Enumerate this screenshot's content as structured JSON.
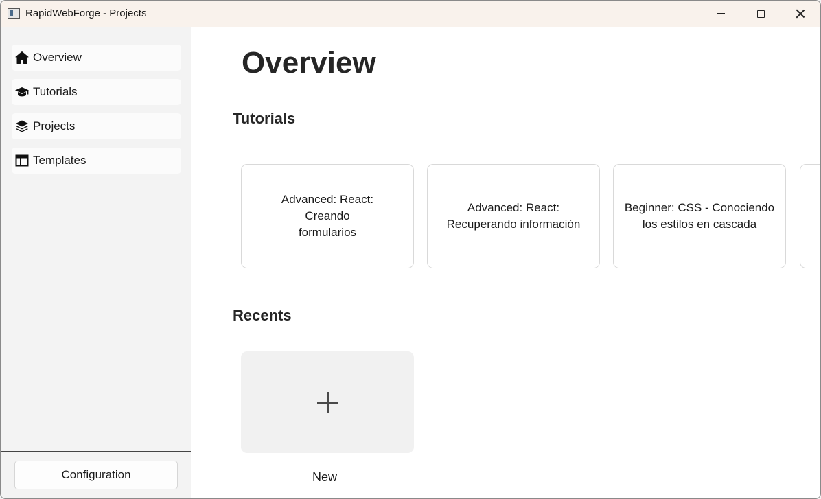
{
  "window": {
    "title": "RapidWebForge - Projects",
    "controls": [
      "minimize",
      "maximize",
      "close"
    ]
  },
  "sidebar": {
    "items": [
      {
        "label": "Overview",
        "icon": "home-icon"
      },
      {
        "label": "Tutorials",
        "icon": "graduation-cap-icon"
      },
      {
        "label": "Projects",
        "icon": "layers-icon"
      },
      {
        "label": "Templates",
        "icon": "table-icon"
      }
    ],
    "config_label": "Configuration"
  },
  "main": {
    "title": "Overview",
    "tutorials_heading": "Tutorials",
    "tutorials": [
      {
        "title": "Advanced: React: Creando formularios"
      },
      {
        "title": "Advanced: React: Recuperando información"
      },
      {
        "title": "Beginner: CSS - Conociendo los estilos en cascada"
      }
    ],
    "recents_heading": "Recents",
    "new_label": "New",
    "new_icon": "plus-icon"
  }
}
